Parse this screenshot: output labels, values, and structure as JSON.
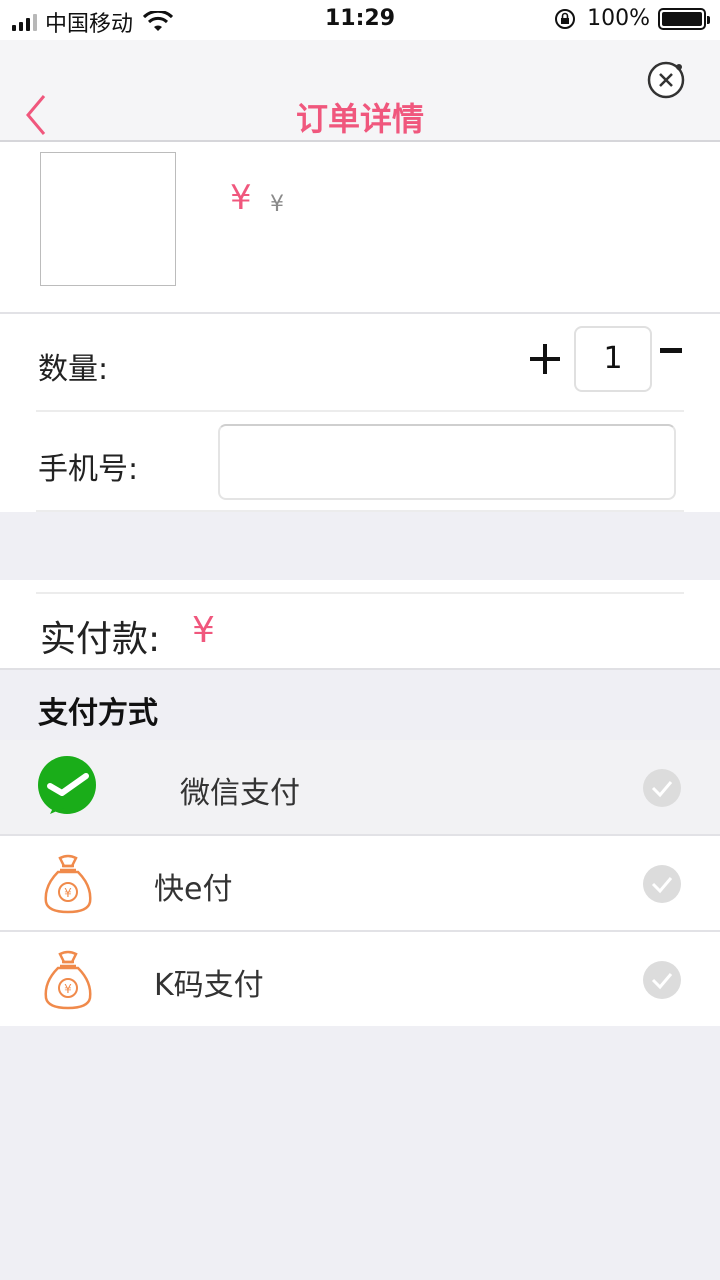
{
  "status_bar": {
    "carrier": "中国移动",
    "time": "11:29",
    "battery": "100%"
  },
  "nav": {
    "title": "订单详情",
    "back_icon": "chevron-left-icon",
    "close_icon": "close-circle-icon"
  },
  "product": {
    "price_symbol": "¥",
    "original_price_symbol": "¥"
  },
  "form": {
    "quantity_label": "数量:",
    "quantity_value": "1",
    "plus_symbol": "+",
    "minus_symbol": "-",
    "phone_label": "手机号:",
    "phone_value": ""
  },
  "total": {
    "label": "实付款:",
    "value": "¥"
  },
  "payment": {
    "title": "支付方式",
    "methods": [
      {
        "label": "微信支付",
        "icon": "wechat-pay-icon",
        "selected": true
      },
      {
        "label": "快e付",
        "icon": "money-bag-icon",
        "selected": false
      },
      {
        "label": "K码支付",
        "icon": "money-bag-icon",
        "selected": false
      }
    ]
  },
  "colors": {
    "accent": "#f0577d",
    "wechat_green": "#1aad19",
    "bag_orange": "#f08a4b"
  }
}
